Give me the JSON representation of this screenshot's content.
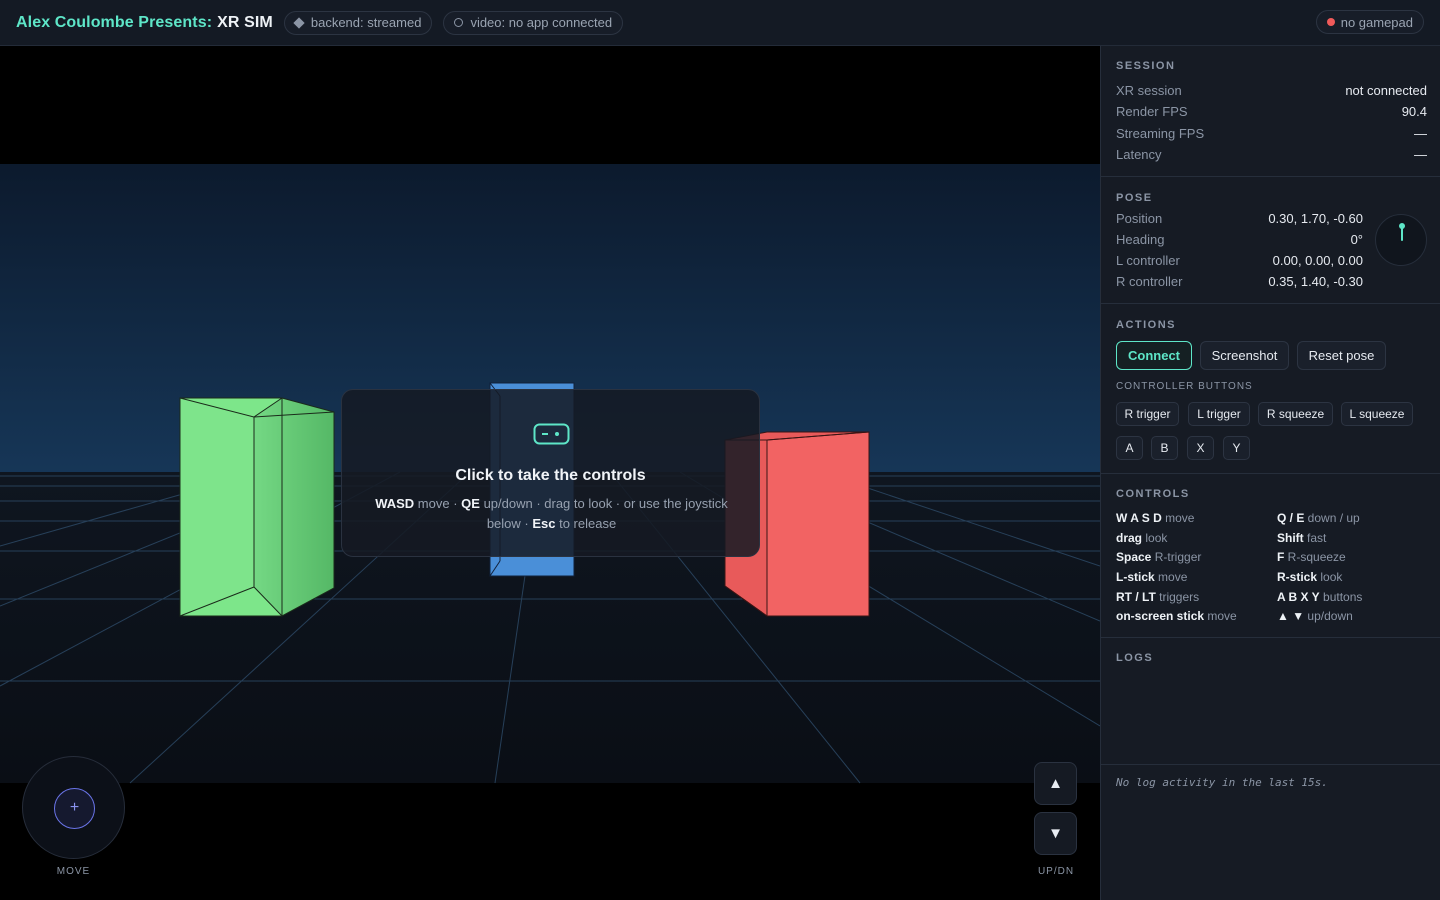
{
  "header": {
    "brand": "Alex Coulombe Presents:",
    "app": "XR SIM",
    "backend_pill": "backend: streamed",
    "video_pill": "video: no app connected",
    "gamepad_pill": "no gamepad"
  },
  "viewport": {
    "overlay_title": "Click to take the controls",
    "hint": {
      "k1": "WASD",
      "t1": " move · ",
      "k2": "QE",
      "t2": " up/down · drag to look · or use the joystick below · ",
      "k3": "Esc",
      "t3": " to release"
    },
    "joystick_label": "MOVE",
    "updown_label": "UP/DN",
    "up_glyph": "▲",
    "down_glyph": "▼",
    "joystick_glyph": "+"
  },
  "session": {
    "title": "SESSION",
    "rows": [
      {
        "label": "XR session",
        "value": "not connected"
      },
      {
        "label": "Render FPS",
        "value": "90.4"
      },
      {
        "label": "Streaming FPS",
        "value": "—"
      },
      {
        "label": "Latency",
        "value": "—"
      }
    ]
  },
  "pose": {
    "title": "POSE",
    "rows": [
      {
        "label": "Position",
        "value": "0.30, 1.70, -0.60"
      },
      {
        "label": "Heading",
        "value": "0°"
      },
      {
        "label": "L controller",
        "value": "0.00, 0.00, 0.00"
      },
      {
        "label": "R controller",
        "value": "0.35, 1.40, -0.30"
      }
    ],
    "heading_deg": 0
  },
  "actions": {
    "title": "ACTIONS",
    "connect": "Connect",
    "screenshot": "Screenshot",
    "reset": "Reset pose",
    "controller_title": "CONTROLLER BUTTONS",
    "buttons": [
      "R trigger",
      "L trigger",
      "R squeeze",
      "L squeeze",
      "A",
      "B",
      "X",
      "Y"
    ]
  },
  "controls": {
    "title": "CONTROLS",
    "items": [
      {
        "key": "W A S D",
        "desc": " move"
      },
      {
        "key": "Q / E",
        "desc": " down / up"
      },
      {
        "key": "drag",
        "desc": " look"
      },
      {
        "key": "Shift",
        "desc": " fast"
      },
      {
        "key": "Space",
        "desc": " R-trigger"
      },
      {
        "key": "F",
        "desc": " R-squeeze"
      },
      {
        "key": "L-stick",
        "desc": " move"
      },
      {
        "key": "R-stick",
        "desc": " look"
      },
      {
        "key": "RT / LT",
        "desc": " triggers"
      },
      {
        "key": "A B X Y",
        "desc": " buttons"
      },
      {
        "key": "on-screen stick",
        "desc": " move"
      },
      {
        "key": "▲ ▼",
        "desc": " up/down"
      }
    ]
  },
  "logs": {
    "title": "LOGS",
    "message": "No log activity in the last 15s."
  },
  "colors": {
    "accent": "#5ee6c8",
    "error": "#f05a5a",
    "cube_green": "#7de68a",
    "cube_blue": "#4a8fd8",
    "cube_red": "#f26363"
  }
}
